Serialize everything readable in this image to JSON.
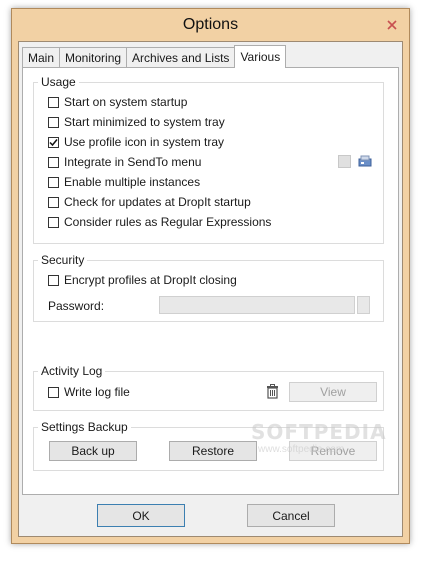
{
  "window": {
    "title": "Options"
  },
  "tabs": [
    {
      "label": "Main"
    },
    {
      "label": "Monitoring"
    },
    {
      "label": "Archives and Lists"
    },
    {
      "label": "Various",
      "active": true
    }
  ],
  "usage": {
    "title": "Usage",
    "options": [
      {
        "label": "Start on system startup",
        "checked": false
      },
      {
        "label": "Start minimized to system tray",
        "checked": false
      },
      {
        "label": "Use profile icon in system tray",
        "checked": true
      },
      {
        "label": "Integrate in SendTo menu",
        "checked": false
      },
      {
        "label": "Enable multiple instances",
        "checked": false
      },
      {
        "label": "Check for updates at DropIt startup",
        "checked": false
      },
      {
        "label": "Consider rules as Regular Expressions",
        "checked": false
      }
    ]
  },
  "security": {
    "title": "Security",
    "encrypt_label": "Encrypt profiles at DropIt closing",
    "encrypt_checked": false,
    "password_label": "Password:",
    "password_value": ""
  },
  "activity_log": {
    "title": "Activity Log",
    "write_log_label": "Write log file",
    "write_log_checked": false,
    "view_label": "View"
  },
  "settings_backup": {
    "title": "Settings Backup",
    "backup_label": "Back up",
    "restore_label": "Restore",
    "remove_label": "Remove"
  },
  "footer": {
    "ok_label": "OK",
    "cancel_label": "Cancel"
  },
  "watermark": {
    "text": "SOFTPEDIA",
    "sub": "www.softpedia.com"
  },
  "colors": {
    "frame": "#f2d1a4",
    "close_button": "#c75050",
    "default_button_border": "#3c7fb1"
  }
}
